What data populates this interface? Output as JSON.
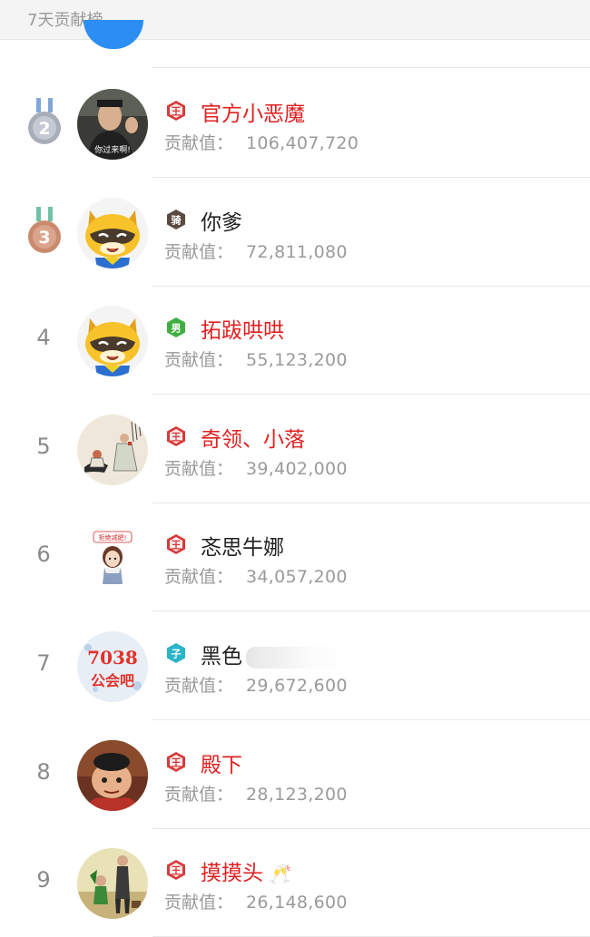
{
  "header": {
    "title": "7天贡献榜"
  },
  "labels": {
    "contrib": "贡献值："
  },
  "colors": {
    "red_name": "#e02020",
    "black_name": "#222222",
    "badge_red": "#d83a3a",
    "badge_green": "#3fae3f",
    "badge_teal": "#2ab4c8",
    "badge_brown": "#5a4a42"
  },
  "rows": [
    {
      "rank": "",
      "medal": "silver",
      "medal_digit": "2",
      "name": "官方小恶魔",
      "name_style": "red",
      "badge": "王",
      "badge_style": "red",
      "contrib": "106,407,720",
      "avatar": "photo-man",
      "avatar_caption": "你过来啊!"
    },
    {
      "rank": "",
      "medal": "bronze",
      "medal_digit": "3",
      "name": "你爹",
      "name_style": "black",
      "badge": "骑",
      "badge_style": "brown",
      "contrib": "72,811,080",
      "avatar": "yy-raccoon"
    },
    {
      "rank": "4",
      "name": "拓跋哄哄",
      "name_style": "red",
      "badge": "男",
      "badge_style": "green",
      "contrib": "55,123,200",
      "avatar": "yy-raccoon"
    },
    {
      "rank": "5",
      "name": "奇领、小落",
      "name_style": "red",
      "badge": "王",
      "badge_style": "red",
      "contrib": "39,402,000",
      "avatar": "ink-painting"
    },
    {
      "rank": "6",
      "name": "忞思牛娜",
      "name_style": "black",
      "badge": "王",
      "badge_style": "red",
      "contrib": "34,057,200",
      "avatar": "cartoon-girl",
      "avatar_caption": "拒绝减肥!"
    },
    {
      "rank": "7",
      "name": "黑色",
      "name_style": "black",
      "badge": "子",
      "badge_style": "teal",
      "contrib": "29,672,600",
      "avatar": "text-7038",
      "avatar_text_1": "7038",
      "avatar_text_2": "公会吧",
      "blurred_suffix": true
    },
    {
      "rank": "8",
      "name": "殿下",
      "name_style": "red",
      "badge": "王",
      "badge_style": "red",
      "contrib": "28,123,200",
      "avatar": "cartoon-boy"
    },
    {
      "rank": "9",
      "name": "摸摸头",
      "name_style": "red",
      "badge": "王",
      "badge_style": "red",
      "contrib": "26,148,600",
      "avatar": "movie-poster",
      "emoji": "🥂"
    }
  ]
}
